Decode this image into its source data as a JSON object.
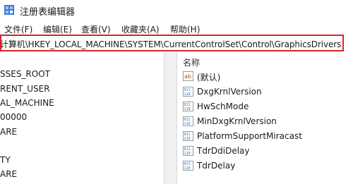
{
  "window": {
    "title": "注册表编辑器",
    "app_icon": "regedit-icon"
  },
  "menu": [
    {
      "label": "文件(F)"
    },
    {
      "label": "编辑(E)"
    },
    {
      "label": "查看(V)"
    },
    {
      "label": "收藏夹(A)"
    },
    {
      "label": "帮助(H)"
    }
  ],
  "address": {
    "path": "计算机\\HKEY_LOCAL_MACHINE\\SYSTEM\\CurrentControlSet\\Control\\GraphicsDrivers"
  },
  "tree": [
    {
      "label": "SSES_ROOT"
    },
    {
      "label": "RENT_USER"
    },
    {
      "label": "AL_MACHINE"
    },
    {
      "label": "00000"
    },
    {
      "label": "ARE"
    },
    {
      "label": "TY"
    },
    {
      "label": "ARE"
    }
  ],
  "values_pane": {
    "column_name": "名称",
    "items": [
      {
        "name": "(默认)",
        "icon": "string-value-icon"
      },
      {
        "name": "DxgKrnlVersion",
        "icon": "binary-value-icon"
      },
      {
        "name": "HwSchMode",
        "icon": "binary-value-icon"
      },
      {
        "name": "MinDxgKrnlVersion",
        "icon": "binary-value-icon"
      },
      {
        "name": "PlatformSupportMiracast",
        "icon": "binary-value-icon"
      },
      {
        "name": "TdrDdiDelay",
        "icon": "binary-value-icon"
      },
      {
        "name": "TdrDelay",
        "icon": "binary-value-icon"
      }
    ]
  },
  "colors": {
    "highlight_border": "#d9232a",
    "icon_blue": "#2a6ebb",
    "icon_red": "#c0392b"
  }
}
